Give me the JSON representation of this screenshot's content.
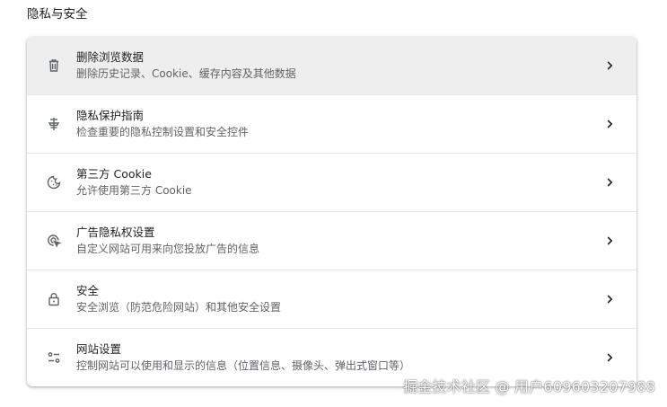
{
  "section": {
    "title": "隐私与安全"
  },
  "rows": [
    {
      "icon": "trash-icon",
      "title": "删除浏览数据",
      "description": "删除历史记录、Cookie、缓存内容及其他数据",
      "highlighted": true
    },
    {
      "icon": "privacy-guide-icon",
      "title": "隐私保护指南",
      "description": "检查重要的隐私控制设置和安全控件",
      "highlighted": false
    },
    {
      "icon": "cookie-icon",
      "title": "第三方 Cookie",
      "description": "允许使用第三方 Cookie",
      "highlighted": false
    },
    {
      "icon": "ad-privacy-icon",
      "title": "广告隐私权设置",
      "description": "自定义网站可用来向您投放广告的信息",
      "highlighted": false
    },
    {
      "icon": "lock-icon",
      "title": "安全",
      "description": "安全浏览（防范危险网站）和其他安全设置",
      "highlighted": false
    },
    {
      "icon": "site-settings-icon",
      "title": "网站设置",
      "description": "控制网站可以使用和显示的信息（位置信息、摄像头、弹出式窗口等）",
      "highlighted": false
    }
  ],
  "watermark": {
    "text": "掘金技术社区 @ 用户609603207988"
  },
  "colors": {
    "hover_row": "#eeeeee",
    "title_text": "#202124",
    "secondary_text": "#5f6368",
    "icon": "#5f6368"
  }
}
